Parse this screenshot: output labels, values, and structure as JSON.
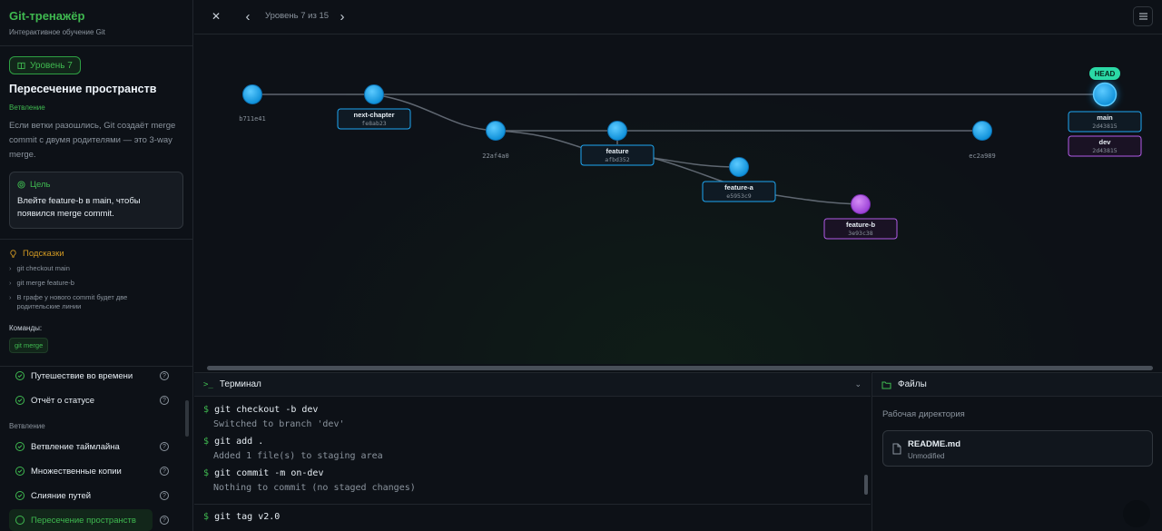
{
  "brand": {
    "title": "Git-тренажёр",
    "subtitle": "Интерактивное обучение Git"
  },
  "lesson": {
    "level_badge": "Уровень 7",
    "title": "Пересечение пространств",
    "tag": "Ветвление",
    "description": "Если ветки разошлись, Git создаёт merge commit с двумя родителями — это 3-way merge.",
    "goal_label": "Цель",
    "goal_text": "Влейте feature-b в main, чтобы появился merge commit."
  },
  "hints": {
    "label": "Подсказки",
    "items": [
      "git checkout main",
      "git merge feature-b",
      "В графе у нового commit будет две родительские линии"
    ],
    "commands_label": "Команды:",
    "commands": [
      "git merge"
    ]
  },
  "levels": {
    "items": [
      {
        "label": "Путешествие во времени"
      },
      {
        "label": "Отчёт о статусе"
      },
      {
        "label": "Ветвление таймлайна"
      },
      {
        "label": "Множественные копии"
      },
      {
        "label": "Слияние путей"
      },
      {
        "label": "Пересечение пространств"
      }
    ],
    "section_branching": "Ветвление"
  },
  "topbar": {
    "close": "✕",
    "prev": "‹",
    "next": "›",
    "title": "Уровень 7 из 15"
  },
  "graph": {
    "head_label": "HEAD",
    "commits": [
      {
        "hash": "b711e41"
      },
      {
        "hash": "fe8ab23"
      },
      {
        "hash": "22af4a0"
      },
      {
        "hash": "afbd352"
      },
      {
        "hash": "ec2a989"
      },
      {
        "hash": "2d43815"
      },
      {
        "hash": "e5953c9"
      },
      {
        "hash": "3e93c38"
      }
    ],
    "branches": [
      {
        "name": "next-chapter",
        "hash": "fe8ab23"
      },
      {
        "name": "feature",
        "hash": "afbd352"
      },
      {
        "name": "feature-a",
        "hash": "e5953c9"
      },
      {
        "name": "feature-b",
        "hash": "3e93c38"
      },
      {
        "name": "main",
        "hash": "2d43815"
      },
      {
        "name": "dev",
        "hash": "2d43815"
      }
    ],
    "colors": {
      "blue": "#1ea7f3",
      "purple": "#b25be8",
      "head": "#2bd9a6"
    }
  },
  "terminal": {
    "title": "Терминал",
    "lines": [
      {
        "type": "cmd",
        "text": "git checkout -b dev"
      },
      {
        "type": "out",
        "text": "Switched to branch 'dev'"
      },
      {
        "type": "cmd",
        "text": "git add ."
      },
      {
        "type": "out",
        "text": "Added 1 file(s) to staging area"
      },
      {
        "type": "cmd",
        "text": "git commit -m on-dev"
      },
      {
        "type": "out",
        "text": "Nothing to commit (no staged changes)"
      }
    ],
    "prompt": "$",
    "input_value": "git tag v2.0"
  },
  "files": {
    "title": "Файлы",
    "subtitle": "Рабочая директория",
    "items": [
      {
        "name": "README.md",
        "status": "Unmodified"
      }
    ]
  }
}
